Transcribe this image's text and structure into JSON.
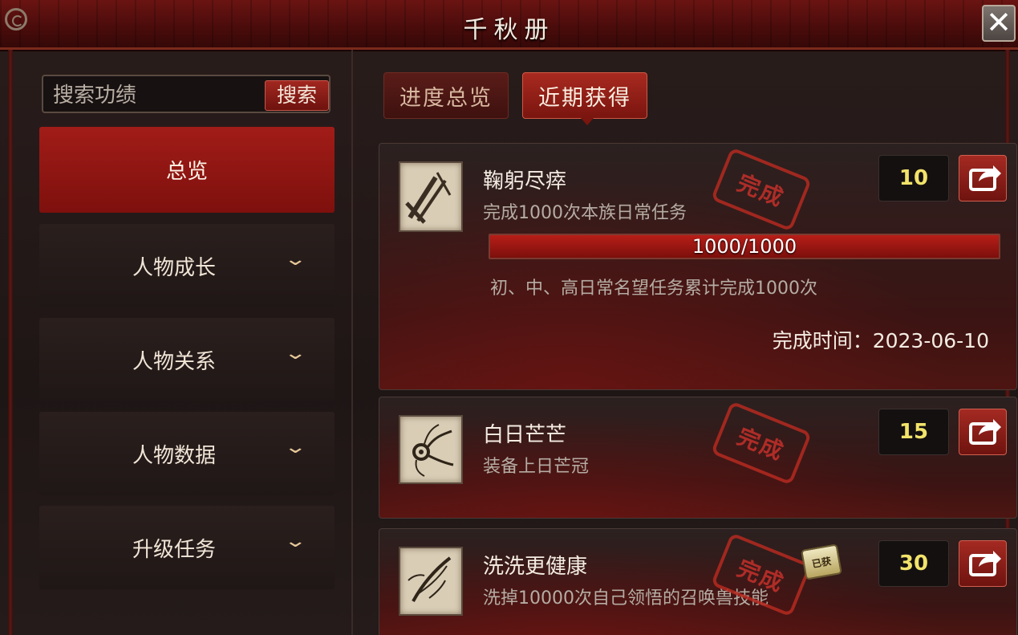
{
  "window": {
    "title": "千秋册",
    "close_glyph": "✕"
  },
  "search": {
    "placeholder": "搜索功绩",
    "button_label": "搜索"
  },
  "categories": {
    "overview": "总览",
    "items": [
      {
        "label": "人物成长"
      },
      {
        "label": "人物关系"
      },
      {
        "label": "人物数据"
      },
      {
        "label": "升级任务"
      }
    ]
  },
  "tabs": {
    "progress_label": "进度总览",
    "recent_label": "近期获得",
    "active": "近期获得"
  },
  "achievements": [
    {
      "name": "鞠躬尽瘁",
      "desc": "完成1000次本族日常任务",
      "stamp": "完成",
      "points": "10",
      "progress_text": "1000/1000",
      "progress_fraction": 1.0,
      "note": "初、中、高日常名望任务累计完成1000次",
      "time_label": "完成时间：",
      "time_value": "2023-06-10",
      "icon": "crossed-sticks-icon"
    },
    {
      "name": "白日芒芒",
      "desc": "装备上日芒冠",
      "stamp": "完成",
      "points": "15",
      "icon": "sun-crown-icon"
    },
    {
      "name": "洗洗更健康",
      "desc": "洗掉10000次自己领悟的召唤兽技能",
      "stamp": "完成",
      "points": "30",
      "badge": "已获",
      "icon": "feather-brush-icon"
    }
  ],
  "colors": {
    "accent_red": "#a11c18",
    "points_yellow": "#f2e36a"
  }
}
